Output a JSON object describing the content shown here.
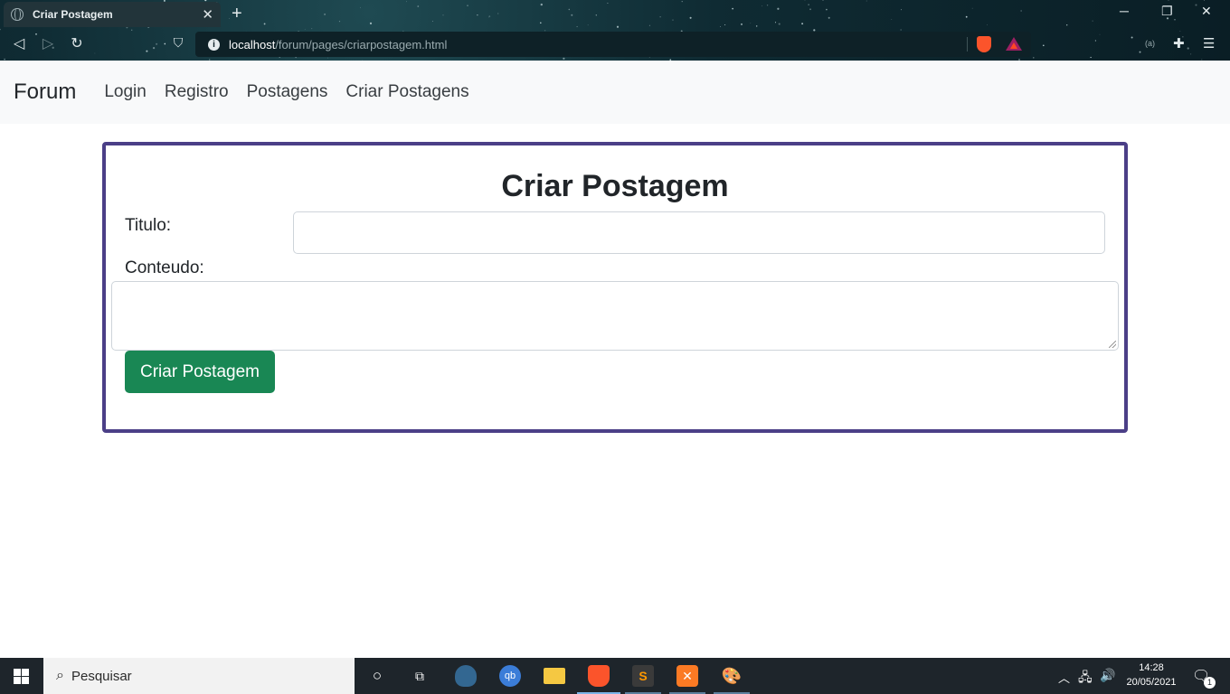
{
  "browser": {
    "tab_title": "Criar Postagem",
    "tab_close": "✕",
    "new_tab": "+",
    "url_host": "localhost",
    "url_path": "/forum/pages/criarpostagem.html",
    "window_controls": [
      "─",
      "❐",
      "✕"
    ]
  },
  "navbar": {
    "brand": "Forum",
    "links": [
      "Login",
      "Registro",
      "Postagens",
      "Criar Postagens"
    ]
  },
  "form": {
    "heading": "Criar Postagem",
    "title_label": "Titulo:",
    "title_value": "",
    "content_label": "Conteudo:",
    "content_value": "",
    "submit_label": "Criar Postagem"
  },
  "taskbar": {
    "search_placeholder": "Pesquisar",
    "time": "14:28",
    "date": "20/05/2021",
    "notification_count": "1"
  },
  "colors": {
    "card_border": "#4b3f87",
    "submit_bg": "#198754",
    "navbar_bg": "#f8f9fa",
    "taskbar_bg": "#1e252b"
  }
}
